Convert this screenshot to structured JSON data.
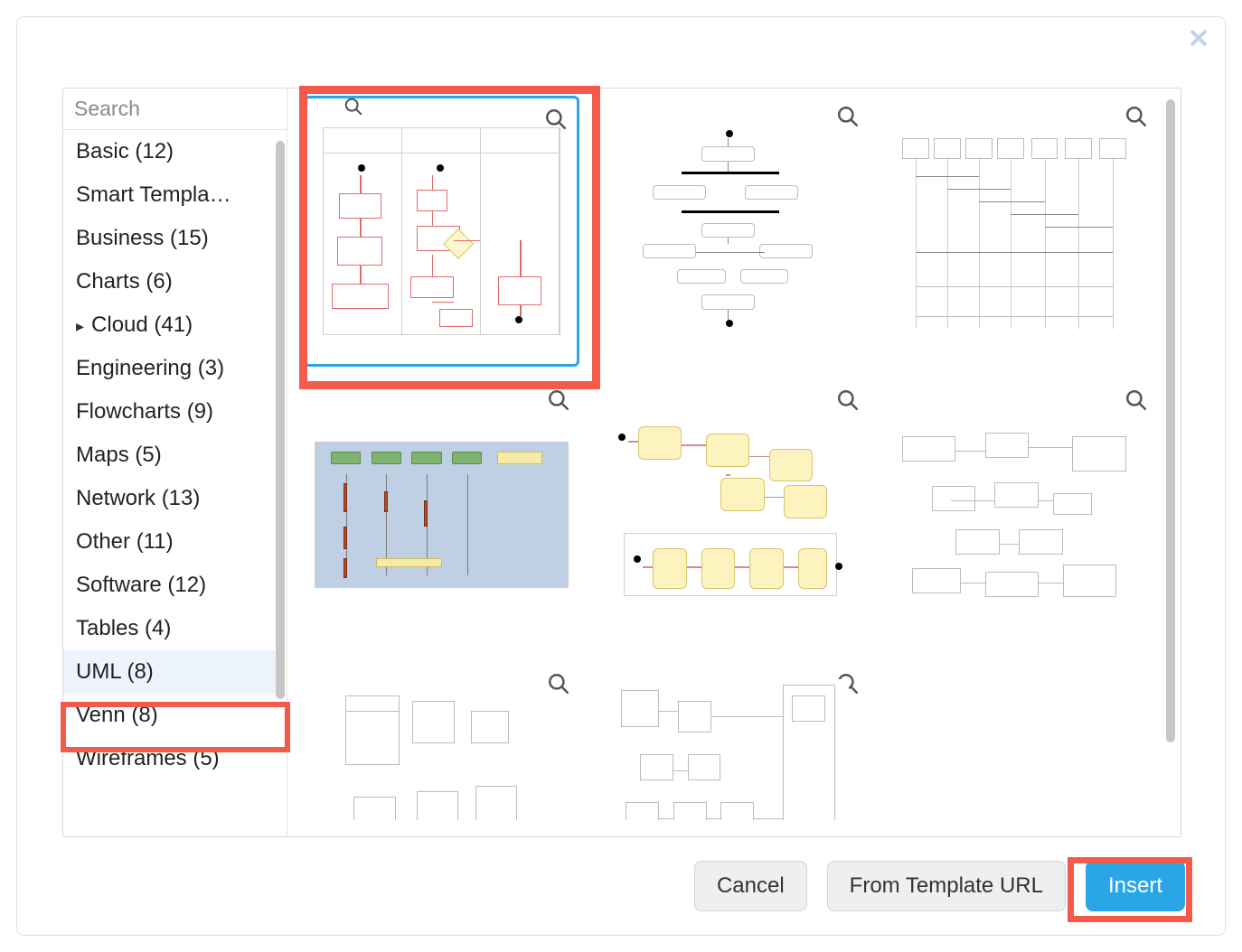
{
  "close_glyph": "✕",
  "search": {
    "placeholder": "Search"
  },
  "categories": [
    {
      "label": "Basic (12)"
    },
    {
      "label": "Smart Templa…"
    },
    {
      "label": "Business (15)"
    },
    {
      "label": "Charts (6)"
    },
    {
      "label": "Cloud (41)",
      "expandable": true
    },
    {
      "label": "Engineering (3)"
    },
    {
      "label": "Flowcharts (9)"
    },
    {
      "label": "Maps (5)"
    },
    {
      "label": "Network (13)"
    },
    {
      "label": "Other (11)"
    },
    {
      "label": "Software (12)"
    },
    {
      "label": "Tables (4)"
    },
    {
      "label": "UML (8)",
      "selected": true
    },
    {
      "label": "Venn (8)"
    },
    {
      "label": "Wireframes (5)"
    }
  ],
  "templates": [
    {
      "name": "uml-activity-swimlanes-1",
      "kind": "swim",
      "selected": true
    },
    {
      "name": "uml-activity-2",
      "kind": "activity"
    },
    {
      "name": "uml-sequence-big-3",
      "kind": "seqbig"
    },
    {
      "name": "uml-sequence-blue-4",
      "kind": "seqblue"
    },
    {
      "name": "uml-state-yellow-5",
      "kind": "statey"
    },
    {
      "name": "uml-class-6",
      "kind": "class"
    },
    {
      "name": "uml-class-detail-7",
      "kind": "uml1"
    },
    {
      "name": "uml-deployment-8",
      "kind": "depl"
    }
  ],
  "footer": {
    "cancel_label": "Cancel",
    "from_url_label": "From Template URL",
    "insert_label": "Insert"
  }
}
